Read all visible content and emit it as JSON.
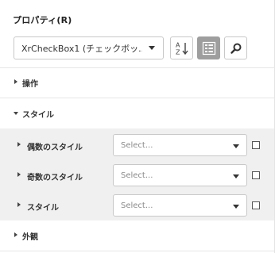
{
  "panel": {
    "title": "プロパティ(R)"
  },
  "selector": {
    "value": "XrCheckBox1 (チェックボッ..."
  },
  "toolbar": {
    "sort_icon": "sort-alphabetical-icon",
    "categories_icon": "categorized-list-icon",
    "search_icon": "search-icon",
    "active_button": "categories"
  },
  "groups": [
    {
      "label": "操作",
      "expanded": false
    },
    {
      "label": "スタイル",
      "expanded": true
    },
    {
      "label": "外観",
      "expanded": false
    }
  ],
  "style_properties": [
    {
      "label": "偶数のスタイル",
      "placeholder": "Select...",
      "checked": false
    },
    {
      "label": "奇数のスタイル",
      "placeholder": "Select...",
      "checked": false
    },
    {
      "label": "スタイル",
      "placeholder": "Select...",
      "checked": false
    }
  ],
  "colors": {
    "active_button_bg": "#9e9e9e",
    "property_area_bg": "#f0f0f0",
    "border": "#c8c8c8"
  }
}
